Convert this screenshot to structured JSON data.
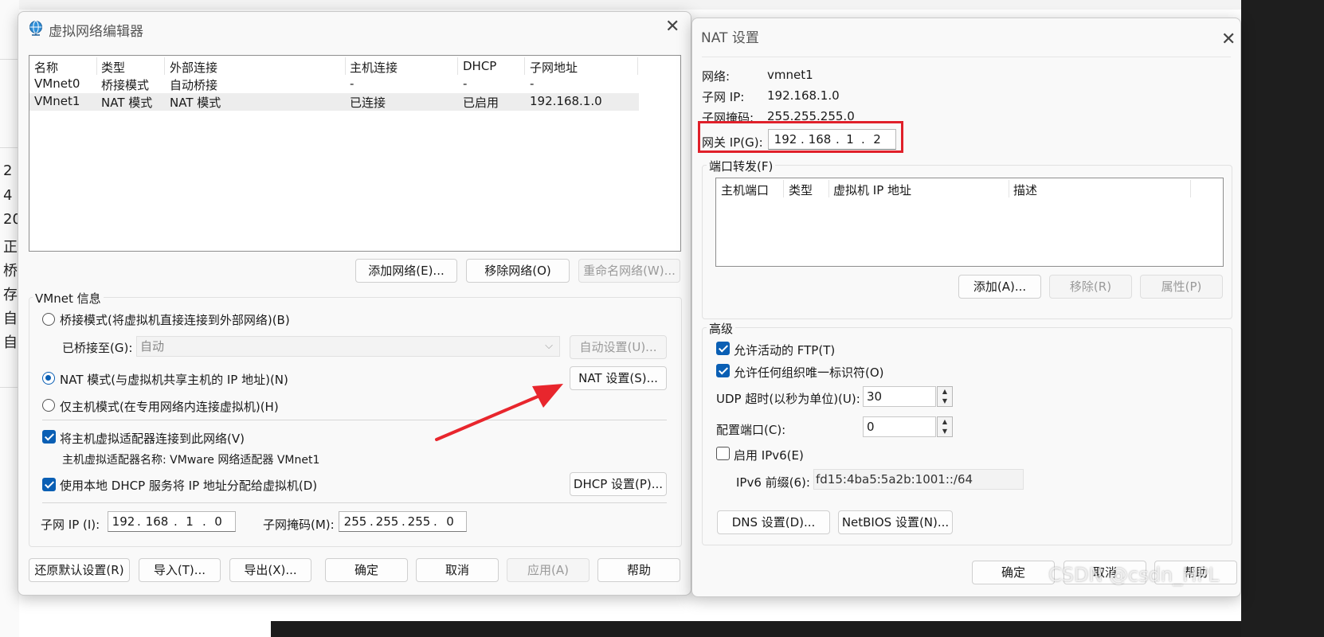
{
  "background": {
    "side_chars": [
      "2 (",
      "4",
      "20",
      "正",
      "桥",
      "存",
      "自",
      "自"
    ]
  },
  "vne": {
    "title": "虚拟网络编辑器",
    "table": {
      "headers": [
        "名称",
        "类型",
        "外部连接",
        "主机连接",
        "DHCP",
        "子网地址"
      ],
      "rows": [
        [
          "VMnet0",
          "桥接模式",
          "自动桥接",
          "-",
          "-",
          "-"
        ],
        [
          "VMnet1",
          "NAT 模式",
          "NAT 模式",
          "已连接",
          "已启用",
          "192.168.1.0"
        ]
      ]
    },
    "buttons": {
      "add_network": "添加网络(E)...",
      "remove_network": "移除网络(O)",
      "rename_network": "重命名网络(W)..."
    },
    "info": {
      "title": "VMnet 信息",
      "bridge_mode": "桥接模式(将虚拟机直接连接到外部网络)(B)",
      "bridged_to_label": "已桥接至(G):",
      "bridged_to_value": "自动",
      "auto_settings": "自动设置(U)...",
      "nat_mode": "NAT 模式(与虚拟机共享主机的 IP 地址)(N)",
      "nat_settings": "NAT 设置(S)...",
      "host_only": "仅主机模式(在专用网络内连接虚拟机)(H)",
      "connect_adapter": "将主机虚拟适配器连接到此网络(V)",
      "adapter_name": "主机虚拟适配器名称: VMware 网络适配器 VMnet1",
      "use_dhcp": "使用本地 DHCP 服务将 IP 地址分配给虚拟机(D)",
      "dhcp_settings": "DHCP 设置(P)...",
      "subnet_ip_label": "子网 IP (I):",
      "subnet_ip": [
        "192",
        "168",
        "1",
        "0"
      ],
      "subnet_mask_label": "子网掩码(M):",
      "subnet_mask": [
        "255",
        "255",
        "255",
        "0"
      ]
    },
    "footer": {
      "restore": "还原默认设置(R)",
      "import": "导入(T)...",
      "export": "导出(X)...",
      "ok": "确定",
      "cancel": "取消",
      "apply": "应用(A)",
      "help": "帮助"
    }
  },
  "nat": {
    "title": "NAT 设置",
    "network_label": "网络:",
    "network_value": "vmnet1",
    "subnet_ip_label": "子网 IP:",
    "subnet_ip_value": "192.168.1.0",
    "subnet_mask_label": "子网掩码:",
    "subnet_mask_value": "255.255.255.0",
    "gateway_label": "网关 IP(G):",
    "gateway_ip": [
      "192",
      "168",
      "1",
      "2"
    ],
    "port_forwarding": {
      "title": "端口转发(F)",
      "headers": [
        "主机端口",
        "类型",
        "虚拟机 IP 地址",
        "描述"
      ],
      "add": "添加(A)...",
      "remove": "移除(R)",
      "properties": "属性(P)"
    },
    "advanced": {
      "title": "高级",
      "allow_ftp": "允许活动的 FTP(T)",
      "allow_oui": "允许任何组织唯一标识符(O)",
      "udp_timeout_label": "UDP 超时(以秒为单位)(U):",
      "udp_timeout_value": "30",
      "config_port_label": "配置端口(C):",
      "config_port_value": "0",
      "enable_ipv6": "启用 IPv6(E)",
      "ipv6_prefix_label": "IPv6 前缀(6):",
      "ipv6_prefix_value": "fd15:4ba5:5a2b:1001::/64"
    },
    "buttons": {
      "dns": "DNS 设置(D)...",
      "netbios": "NetBIOS 设置(N)...",
      "ok": "确定",
      "cancel": "取消",
      "help": "帮助"
    }
  },
  "watermark": "CSDN @csdn_HPL",
  "colors": {
    "highlight_box": "#e0202a",
    "arrow": "#e8262d",
    "accent": "#0a5fb4"
  }
}
